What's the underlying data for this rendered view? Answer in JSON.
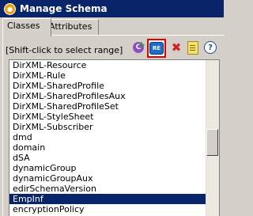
{
  "window": {
    "title": "Manage Schema"
  },
  "tabs": [
    {
      "label": "Classes"
    },
    {
      "label": "Attributes"
    }
  ],
  "hint": "[Shift-click to select range]",
  "toolbar": {
    "add_icon_glyph": "C",
    "re_icon_text": "RE",
    "delete_icon_glyph": "✖",
    "help_icon_glyph": "?"
  },
  "classes": {
    "items": [
      "DirXML-Resource",
      "DirXML-Rule",
      "DirXML-SharedProfile",
      "DirXML-SharedProfilesAux",
      "DirXML-SharedProfileSet",
      "DirXML-StyleSheet",
      "DirXML-Subscriber",
      "dmd",
      "domain",
      "dSA",
      "dynamicGroup",
      "dynamicGroupAux",
      "edirSchemaVersion",
      "EmpInf",
      "encryptionPolicy"
    ],
    "selected": "EmpInf"
  }
}
